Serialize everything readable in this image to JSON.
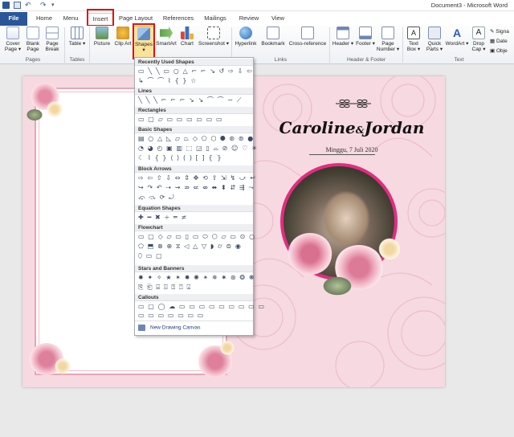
{
  "window": {
    "title": "Document3 - Microsoft Word"
  },
  "tabs": [
    {
      "label": "File"
    },
    {
      "label": "Home"
    },
    {
      "label": "Menu"
    },
    {
      "label": "Insert"
    },
    {
      "label": "Page Layout"
    },
    {
      "label": "References"
    },
    {
      "label": "Mailings"
    },
    {
      "label": "Review"
    },
    {
      "label": "View"
    }
  ],
  "ribbon": {
    "pages": {
      "cover": "Cover Page ▾",
      "blank": "Blank Page",
      "break": "Page Break",
      "group": "Pages"
    },
    "tables": {
      "table": "Table ▾",
      "group": "Tables"
    },
    "illustrations": {
      "picture": "Picture",
      "clipart": "Clip Art",
      "shapes": "Shapes ▾",
      "smartart": "SmartArt",
      "chart": "Chart",
      "screenshot": "Screenshot ▾"
    },
    "links": {
      "hyperlink": "Hyperlink",
      "bookmark": "Bookmark",
      "crossref": "Cross-reference",
      "group": "Links"
    },
    "headerfooter": {
      "header": "Header ▾",
      "footer": "Footer ▾",
      "pagenumber": "Page Number ▾",
      "group": "Header & Footer"
    },
    "text": {
      "textbox": "Text Box ▾",
      "quickparts": "Quick Parts ▾",
      "wordart": "WordArt ▾",
      "dropcap": "Drop Cap ▾",
      "signature": "Signa",
      "datetime": "Date",
      "object": "Obje",
      "group": "Text"
    }
  },
  "shapes_menu": {
    "sections": [
      {
        "label": "Recently Used Shapes",
        "rows": [
          "▭ ╲ ╲ ▭ ○ △ ⌐ ⌐ ↘ ↺ ⇨ ⇩ ⇦",
          "↳ ⌒ ⌒ ⌇ { } ☆"
        ]
      },
      {
        "label": "Lines",
        "rows": [
          "╲ ╲ ╲ ⌐ ⌐ ⌐ ↘ ↘ ⌒ ⌒ ∼ ⟋"
        ]
      },
      {
        "label": "Rectangles",
        "rows": [
          "▭ ▢ ▱ ▭ ▭ ▭ ▭ ▭ ▭"
        ]
      },
      {
        "label": "Basic Shapes",
        "rows": [
          "▤ ○ △ ◺ ▱ ⏢ ◇ ⬠ ⬡ ⯃ ⊛ ⊚ ●",
          "◔ ◕ ◴ ▣ ▥ ⬚ ◲ ▯ ⌓ ⊘ ☺ ♡ ☀",
          "☾ ⌇ { } ⟨ ⟩ ( ) [ ] ⦃ ⦄"
        ]
      },
      {
        "label": "Block Arrows",
        "rows": [
          "⇨ ⇦ ⇧ ⇩ ⇔ ⇕ ✥ ⟲ ⇪ ⇲ ↯ ⤻ ↩",
          "↪ ↷ ↶ ⇢ ⇝ ⇏ ⇍ ⇎ ⬌ ⬍ ⇵ ⇶ ⤳",
          "⤽ ⤼ ⟳ ⤾"
        ]
      },
      {
        "label": "Equation Shapes",
        "rows": [
          "✚ ━ ✖ ÷ ═ ≠"
        ]
      },
      {
        "label": "Flowchart",
        "rows": [
          "▭ ▢ ◇ ▱ ▭ ▯ ▭ ⬭ ⬡ ▱ ▭ ⊙ ○",
          "⬠ ⬒ ⊗ ⊕ ⧖ ◁ △ ▽ ◗ ⌭ ⊜ ◉",
          "⬯ ▭ ▢"
        ]
      },
      {
        "label": "Stars and Banners",
        "rows": [
          "✸ ✦ ✧ ★ ✶ ✹ ✺ ✴ ✵ ✷ ⊛ ❂ ❋",
          "⎘ ⎗ ⌸ ⌹ ⍰ ⍞ ⌺"
        ]
      },
      {
        "label": "Callouts",
        "rows": [
          "▭ ▢ ◯ ☁ ▭ ▭ ▭ ▭ ▭ ▭ ▭ ▭ ▭",
          "▭ ▭ ▭ ▭ ▭ ▭ ▭"
        ]
      }
    ],
    "footer": "New Drawing Canvas"
  },
  "document": {
    "names": {
      "first": "Caroline",
      "amp": "&",
      "second": "Jordan"
    },
    "date": "Minggu, 7 Juli 2020"
  },
  "colors": {
    "accent": "#2a5699",
    "highlight": "#e01010",
    "page_bg": "#f6d9e1",
    "ring": "#e02d80"
  }
}
